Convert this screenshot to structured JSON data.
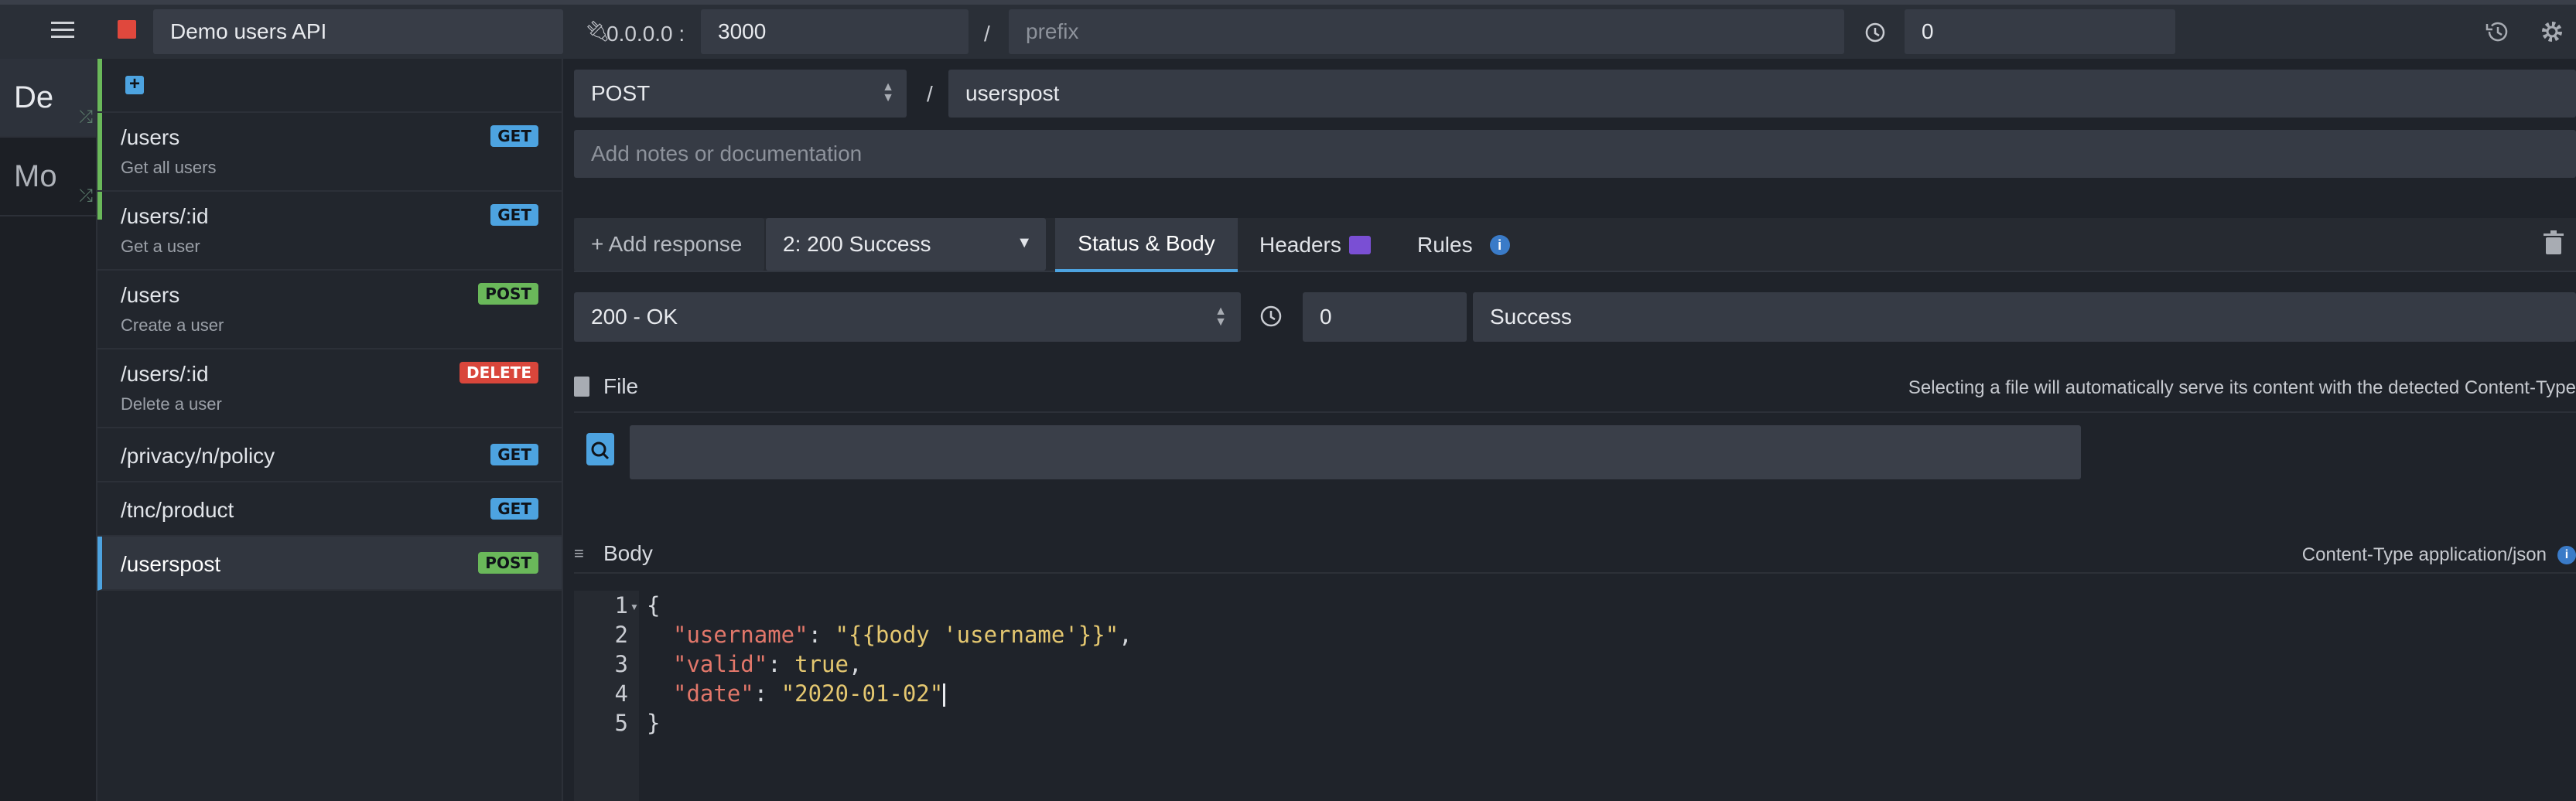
{
  "colors": {
    "accent": "#4da3e0",
    "stop": "#e0483d",
    "active_green": "#6ab85a"
  },
  "topbar": {
    "menu_icon": "hamburger-icon",
    "stop_icon": "stop-icon",
    "env_name": "Demo users API",
    "host_label": "0.0.0.0 :",
    "port": "3000",
    "slash": "/",
    "prefix_placeholder": "prefix",
    "latency": "0",
    "history_icon": "history-icon",
    "settings_icon": "gear-icon"
  },
  "environments": [
    {
      "label": "De"
    },
    {
      "label": "Mo"
    }
  ],
  "routes": [
    {
      "path": "/users",
      "desc": "Get all users",
      "method": "GET"
    },
    {
      "path": "/users/:id",
      "desc": "Get a user",
      "method": "GET"
    },
    {
      "path": "/users",
      "desc": "Create a user",
      "method": "POST"
    },
    {
      "path": "/users/:id",
      "desc": "Delete a user",
      "method": "DELETE"
    },
    {
      "path": "/privacy/n/policy",
      "desc": "",
      "method": "GET"
    },
    {
      "path": "/tnc/product",
      "desc": "",
      "method": "GET"
    },
    {
      "path": "/userspost",
      "desc": "",
      "method": "POST"
    }
  ],
  "route_editor": {
    "method": "POST",
    "slash": "/",
    "endpoint": "userspost",
    "notes_placeholder": "Add notes or documentation"
  },
  "response_tabs": {
    "add_response": "+ Add response",
    "selected_response": "2: 200  Success",
    "tabs": [
      "Status & Body",
      "Headers",
      "Rules"
    ]
  },
  "response": {
    "status": "200 - OK",
    "delay": "0",
    "label": "Success"
  },
  "file": {
    "title": "File",
    "hint": "Selecting a file will automatically serve its content with the detected Content-Type"
  },
  "body": {
    "title": "Body",
    "content_type": "Content-Type application/json",
    "line_numbers": [
      "1",
      "2",
      "3",
      "4",
      "5"
    ],
    "lines": [
      {
        "open": "{"
      },
      {
        "key": "\"username\"",
        "colon": ": ",
        "val": "\"{{body 'username'}}\"",
        "tail": ","
      },
      {
        "key": "\"valid\"",
        "colon": ": ",
        "val": "true",
        "tail": ","
      },
      {
        "key": "\"date\"",
        "colon": ": ",
        "val": "\"2020-01-02\"",
        "tail": ""
      },
      {
        "open": "}"
      }
    ]
  }
}
